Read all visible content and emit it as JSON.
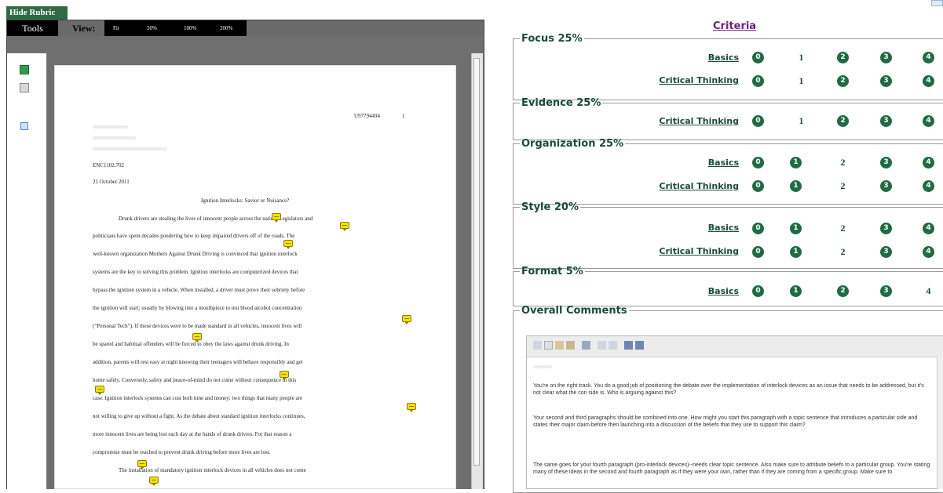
{
  "hide_rubric": "Hide Rubric",
  "viewer": {
    "tools_label": "Tools",
    "view_label": "View:",
    "zoom_options": [
      "Fit",
      "50%",
      "100%",
      "200%"
    ]
  },
  "document": {
    "header_id": "U97794494",
    "page_num": "1",
    "course": "ENC1102.702",
    "date": "21 October 2011",
    "title": "Ignition Interlocks: Savior or Nuisance?",
    "lines": [
      "Drunk drivers are stealing the lives of innocent people across the nation. Legislators and",
      "politicians have spent decades pondering how to keep impaired drivers off of the roads. The",
      "well-known organization Mothers Against Drunk Driving is convinced that ignition interlock",
      "systems are the key to solving this problem. Ignition interlocks are computerized devices that",
      "bypass the ignition system in a vehicle. When installed, a driver must prove their sobriety before",
      "the ignition will start; usually by blowing into a mouthpiece to test blood alcohol concentration",
      "(“Personal Tech”). If these devices were to be made standard in all vehicles, innocent lives will",
      "be spared and habitual offenders will be forced to obey the laws against drunk driving. In",
      "addition, parents will rest easy at night knowing their teenagers will behave responsibly and get",
      "home safely. Conversely, safety and peace-of-mind do not come without consequence in this",
      "case. Ignition interlock systems can cost both time and money; two things that many people are",
      "not willing to give up without a fight. As the debate about standard ignition interlocks continues,",
      "more innocent lives are being lost each day at the hands of drunk drivers. For that reason a",
      "compromise must be reached to prevent drunk driving before more lives are lost.",
      "The installation of mandatory ignition interlock devices in all vehicles does not come"
    ]
  },
  "rubric": {
    "heading": "Criteria",
    "groups": [
      {
        "title": "Focus 25%",
        "rows": [
          {
            "label": "Basics",
            "scores": [
              "0",
              "1",
              "2",
              "3",
              "4"
            ]
          },
          {
            "label": "Critical Thinking",
            "scores": [
              "0",
              "1",
              "2",
              "3",
              "4"
            ]
          }
        ]
      },
      {
        "title": "Evidence 25%",
        "rows": [
          {
            "label": "Critical Thinking",
            "scores": [
              "0",
              "1",
              "2",
              "3",
              "4"
            ]
          }
        ]
      },
      {
        "title": "Organization 25%",
        "rows": [
          {
            "label": "Basics",
            "scores": [
              "0",
              "1",
              "2",
              "3",
              "4"
            ]
          },
          {
            "label": "Critical Thinking",
            "scores": [
              "0",
              "1",
              "2",
              "3",
              "4"
            ]
          }
        ]
      },
      {
        "title": "Style 20%",
        "rows": [
          {
            "label": "Basics",
            "scores": [
              "0",
              "1",
              "2",
              "3",
              "4"
            ]
          },
          {
            "label": "Critical Thinking",
            "scores": [
              "0",
              "1",
              "2",
              "3",
              "4"
            ]
          }
        ]
      },
      {
        "title": "Format 5%",
        "rows": [
          {
            "label": "Basics",
            "scores": [
              "0",
              "1",
              "2",
              "3",
              "4"
            ]
          }
        ]
      }
    ],
    "overall_comments_title": "Overall Comments",
    "comments": [
      "You're on the right track. You do a good job of positioning the debate over the implementation of interlock devices as an issue that needs to be addressed, but it's not clear what the con side is. Who is arguing against this?",
      "Your second and third paragraphs should be combined into one. How might you start this paragraph with a topic sentence that introduces a particular side and states their major claim before then launching into a discussion of the beliefs that they use to support this claim?",
      "The same goes for your fourth paragraph (pro-interlock devices)--needs clear topic sentence. Also make sure to attribute beliefs to a particular group. You're stating many of these ideas in the second and fourth paragraph as if they were your own, rather than if they are coming from a specific group. Make sure to"
    ]
  },
  "colors": {
    "rubric_green": "#1f6b44",
    "criteria_purple": "#6d237f",
    "annotation_yellow": "#f2e200"
  }
}
